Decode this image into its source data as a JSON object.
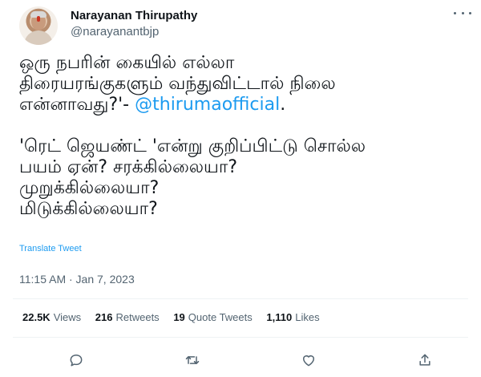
{
  "author": {
    "display_name": "Narayanan Thirupathy",
    "handle": "@narayanantbjp"
  },
  "tweet": {
    "lines": [
      [
        "ஒரு நபரின் கையில் எல்லா"
      ],
      [
        "திரையரங்குகளும் வந்துவிட்டால் நிலை"
      ],
      [
        "என்னாவது?'- ",
        "@thirumaofficial",
        "."
      ],
      [
        ""
      ],
      [
        "'ரெட் ஜெயண்ட் 'என்று குறிப்பிட்டு சொல்ல"
      ],
      [
        "பயம் ஏன்? சரக்கில்லையா?"
      ],
      [
        "முறுக்கில்லையா?"
      ],
      [
        "மிடுக்கில்லையா?"
      ]
    ],
    "translate_label": "Translate Tweet",
    "timestamp": "11:15 AM · Jan 7, 2023"
  },
  "stats": {
    "views_count": "22.5K",
    "views_label": "Views",
    "retweets_count": "216",
    "retweets_label": "Retweets",
    "quotes_count": "19",
    "quotes_label": "Quote Tweets",
    "likes_count": "1,110",
    "likes_label": "Likes"
  },
  "icons": {
    "more": "more-horizontal-icon",
    "reply": "reply-icon",
    "retweet": "retweet-icon",
    "like": "heart-icon",
    "share": "share-icon"
  },
  "colors": {
    "accent": "#1d9bf0",
    "text": "#0f1419",
    "secondary": "#536471"
  }
}
